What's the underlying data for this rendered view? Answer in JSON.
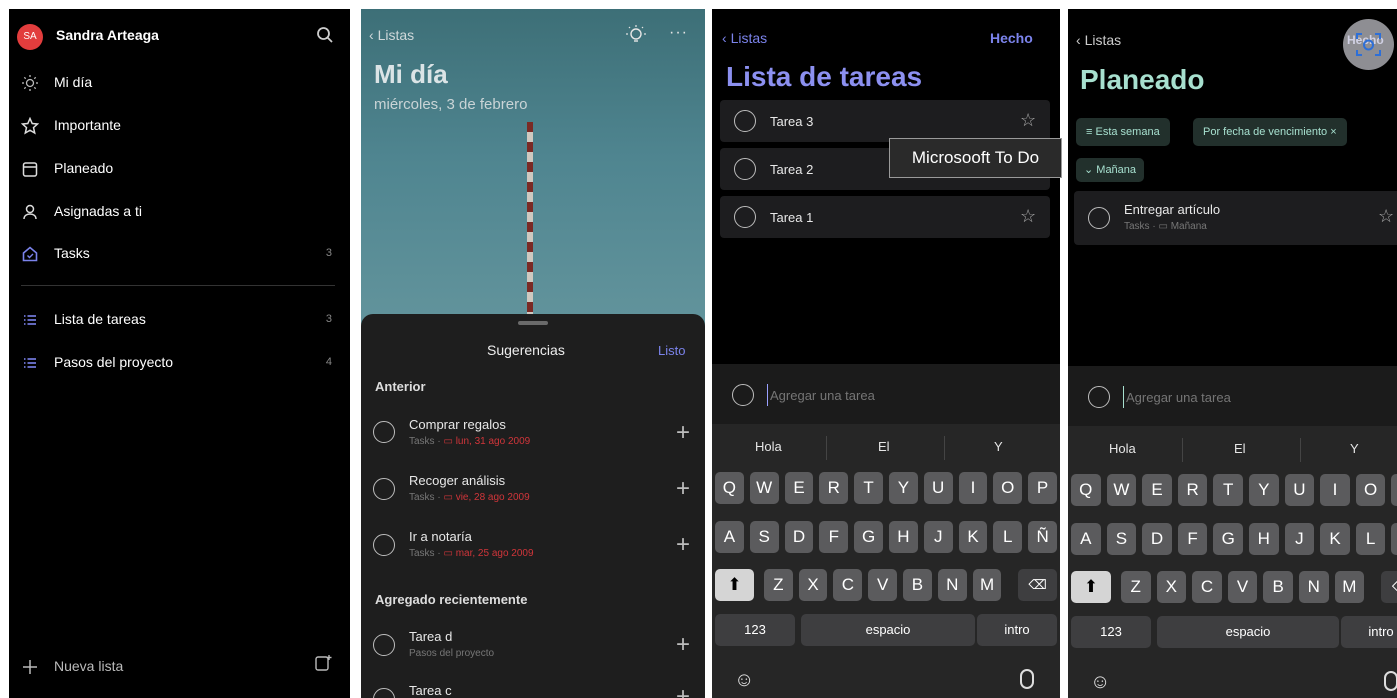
{
  "panel1": {
    "avatar_initials": "SA",
    "user_name": "Sandra Arteaga",
    "nav": [
      {
        "label": "Mi día",
        "icon": "sun-icon",
        "count": ""
      },
      {
        "label": "Importante",
        "icon": "star-icon",
        "count": ""
      },
      {
        "label": "Planeado",
        "icon": "calendar-icon",
        "count": ""
      },
      {
        "label": "Asignadas a ti",
        "icon": "person-icon",
        "count": ""
      },
      {
        "label": "Tasks",
        "icon": "home-icon",
        "count": "3"
      }
    ],
    "lists": [
      {
        "label": "Lista de tareas",
        "count": "3"
      },
      {
        "label": "Pasos del proyecto",
        "count": "4"
      }
    ],
    "new_list": "Nueva lista"
  },
  "panel2": {
    "back": "Listas",
    "title": "Mi día",
    "date": "miércoles, 3 de febrero",
    "sheet_title": "Sugerencias",
    "done": "Listo",
    "section_previous": "Anterior",
    "previous": [
      {
        "title": "Comprar regalos",
        "list": "Tasks",
        "due": "lun, 31 ago 2009"
      },
      {
        "title": "Recoger análisis",
        "list": "Tasks",
        "due": "vie, 28 ago 2009"
      },
      {
        "title": "Ir a notaría",
        "list": "Tasks",
        "due": "mar, 25 ago 2009"
      }
    ],
    "section_recent": "Agregado recientemente",
    "recent": [
      {
        "title": "Tarea d",
        "list": "Pasos del proyecto"
      },
      {
        "title": "Tarea c",
        "list": ""
      }
    ]
  },
  "panel3": {
    "back": "Listas",
    "done": "Hecho",
    "title": "Lista de tareas",
    "tasks": [
      "Tarea 3",
      "Tarea 2",
      "Tarea 1"
    ],
    "add_placeholder": "Agregar una tarea",
    "suggestions": [
      "Hola",
      "El",
      "Y"
    ]
  },
  "tooltip": "Microsooft To Do",
  "panel4": {
    "back": "Listas",
    "title": "Planeado",
    "chip_week": "Esta semana",
    "chip_due": "Por fecha de vencimiento",
    "group": "Mañana",
    "task_title": "Entregar artículo",
    "task_list": "Tasks",
    "task_due": "Mañana",
    "add_placeholder": "Agregar una tarea",
    "suggestions": [
      "Hola",
      "El",
      "Y"
    ],
    "lens_label": "Hecho"
  },
  "keyboard": {
    "row1": [
      "Q",
      "W",
      "E",
      "R",
      "T",
      "Y",
      "U",
      "I",
      "O",
      "P"
    ],
    "row2": [
      "A",
      "S",
      "D",
      "F",
      "G",
      "H",
      "J",
      "K",
      "L",
      "Ñ"
    ],
    "row3": [
      "Z",
      "X",
      "C",
      "V",
      "B",
      "N",
      "M"
    ],
    "numbers": "123",
    "space": "espacio",
    "enter": "intro"
  },
  "colors": {
    "accent_blue": "#7b83eb",
    "accent_teal": "#a7e0cf",
    "due_red": "#d0353a",
    "avatar": "#e23d3d"
  }
}
